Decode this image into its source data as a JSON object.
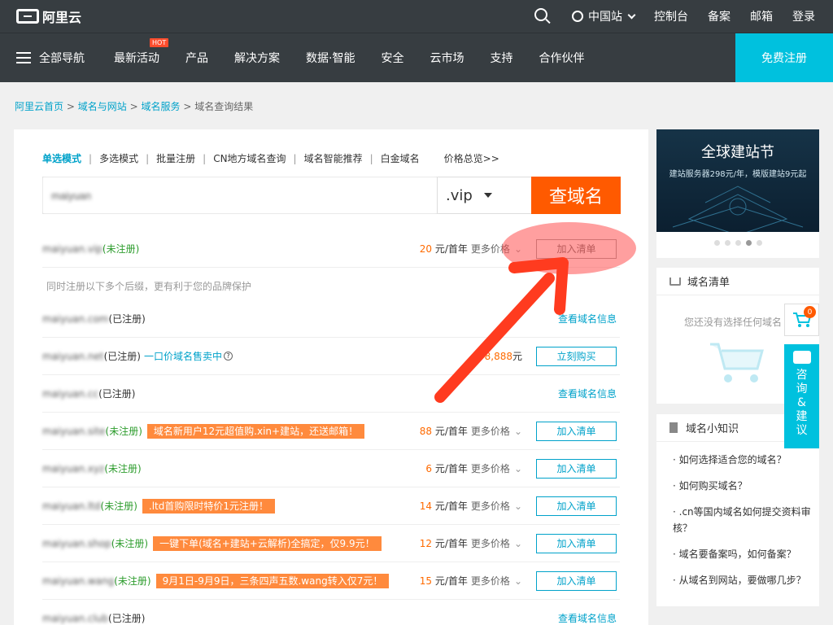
{
  "header": {
    "logo_text": "阿里云",
    "site": "中国站",
    "links": [
      "控制台",
      "备案",
      "邮箱",
      "登录"
    ]
  },
  "nav": {
    "all_nav": "全部导航",
    "items": [
      "最新活动",
      "产品",
      "解决方案",
      "数据·智能",
      "安全",
      "云市场",
      "支持",
      "合作伙伴"
    ],
    "hot_badge": "HOT",
    "register": "免费注册"
  },
  "breadcrumb": {
    "home": "阿里云首页",
    "level1": "域名与网站",
    "level2": "域名服务",
    "current": "域名查询结果",
    "separator": ">"
  },
  "modes": [
    "单选模式",
    "多选模式",
    "批量注册",
    "CN地方域名查询",
    "域名智能推荐",
    "白金域名",
    "价格总览>>"
  ],
  "search": {
    "value": "maiyuan",
    "suffix": ".vip",
    "button": "查域名"
  },
  "primary_result": {
    "name_prefix": "maiyuan.vip",
    "status": "(未注册)",
    "price": "20",
    "unit": "元/首年",
    "more": "更多价格",
    "action": "加入清单"
  },
  "hint": "同时注册以下多个后缀，更有利于您的品牌保护",
  "results": [
    {
      "name": "maiyuan.com",
      "status": "(已注册)",
      "type": "registered",
      "action": "查看域名信息"
    },
    {
      "name": "maiyuan.net",
      "status": "(已注册)",
      "type": "sale",
      "extra": "一口价域名售卖中",
      "price": "8,888",
      "price_unit": "元",
      "action": "立刻购买"
    },
    {
      "name": "maiyuan.cc",
      "status": "(已注册)",
      "type": "registered",
      "action": "查看域名信息"
    },
    {
      "name": "maiyuan.site",
      "status": "(未注册)",
      "type": "unreg",
      "promo": "域名新用户12元超值购.xin+建站，还送邮箱！",
      "price": "88",
      "unit": "元/首年",
      "more": "更多价格",
      "action": "加入清单"
    },
    {
      "name": "maiyuan.xyz",
      "status": "(未注册)",
      "type": "unreg",
      "price": "6",
      "unit": "元/首年",
      "more": "更多价格",
      "action": "加入清单"
    },
    {
      "name": "maiyuan.ltd",
      "status": "(未注册)",
      "type": "unreg",
      "promo": ".ltd首购限时特价1元注册！",
      "price": "14",
      "unit": "元/首年",
      "more": "更多价格",
      "action": "加入清单"
    },
    {
      "name": "maiyuan.shop",
      "status": "(未注册)",
      "type": "unreg",
      "promo": "一键下单(域名+建站+云解析)全搞定，仅9.9元！",
      "price": "12",
      "unit": "元/首年",
      "more": "更多价格",
      "action": "加入清单"
    },
    {
      "name": "maiyuan.wang",
      "status": "(未注册)",
      "type": "unreg",
      "promo": "9月1日-9月9日，三条四声五数.wang转入仅7元！",
      "price": "15",
      "unit": "元/首年",
      "more": "更多价格",
      "action": "加入清单"
    },
    {
      "name": "maiyuan.club",
      "status": "(已注册)",
      "type": "registered",
      "action": "查看域名信息"
    }
  ],
  "sidebar": {
    "banner_title": "全球建站节",
    "banner_sub": "建站服务器298元/年，模版建站9元起",
    "cart_title": "域名清单",
    "cart_empty": "您还没有选择任何域名",
    "tips_title": "域名小知识",
    "tips": [
      "如何选择适合您的域名？",
      "如何购买域名？",
      ".cn等国内域名如何提交资料审核？",
      "域名要备案吗，如何备案？",
      "从域名到网站，要做哪几步？"
    ]
  },
  "float": {
    "cart_count": "0",
    "consult": [
      "咨",
      "询",
      "&",
      "建",
      "议"
    ]
  },
  "colors": {
    "topbar": "#373d41",
    "accent": "#00c1de",
    "link": "#00a2ca",
    "orange": "#ff5a00",
    "annotation": "#ff3b1f"
  }
}
